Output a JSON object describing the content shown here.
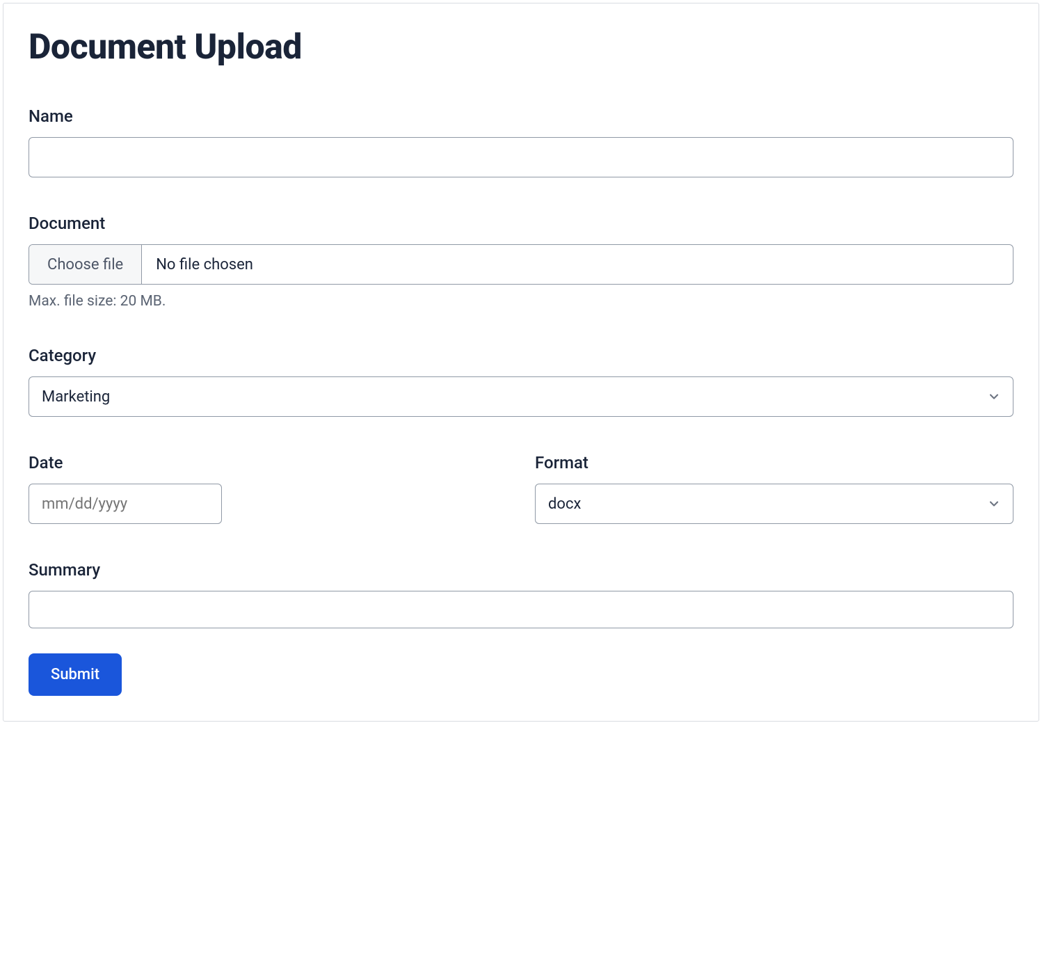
{
  "title": "Document Upload",
  "fields": {
    "name": {
      "label": "Name",
      "value": ""
    },
    "document": {
      "label": "Document",
      "choose_button": "Choose file",
      "status": "No file chosen",
      "help": "Max. file size: 20 MB."
    },
    "category": {
      "label": "Category",
      "selected": "Marketing"
    },
    "date": {
      "label": "Date",
      "placeholder": "mm/dd/yyyy",
      "value": ""
    },
    "format": {
      "label": "Format",
      "selected": "docx"
    },
    "summary": {
      "label": "Summary",
      "value": ""
    }
  },
  "submit_label": "Submit"
}
